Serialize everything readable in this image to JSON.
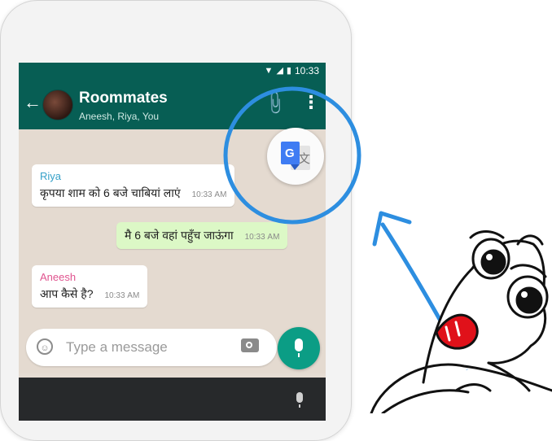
{
  "status_bar": {
    "time": "10:33"
  },
  "header": {
    "title": "Roommates",
    "subtitle": "Aneesh, Riya, You"
  },
  "messages": [
    {
      "sender": "Riya",
      "text": "कृपया शाम को 6 बजे चाबियां लाएं",
      "time": "10:33 AM"
    },
    {
      "sender": "",
      "text": "मै 6 बजे वहां पहुँच जाऊंगा",
      "time": "10:33 AM"
    },
    {
      "sender": "Aneesh",
      "text": "आप कैसे है?",
      "time": "10:33 AM"
    }
  ],
  "composer": {
    "placeholder": "Type a message"
  },
  "colors": {
    "header": "#075e54",
    "accent": "#0b9d85",
    "outgoing": "#dcf8c6",
    "highlight_circle": "#2d8ee0",
    "riya_name": "#35a0c8",
    "aneesh_name": "#e0548f"
  },
  "icons": [
    "back-arrow-icon",
    "attach-icon",
    "menu-icon",
    "google-translate-icon",
    "emoji-icon",
    "camera-icon",
    "mic-icon",
    "wifi-icon",
    "signal-icon",
    "battery-icon"
  ]
}
